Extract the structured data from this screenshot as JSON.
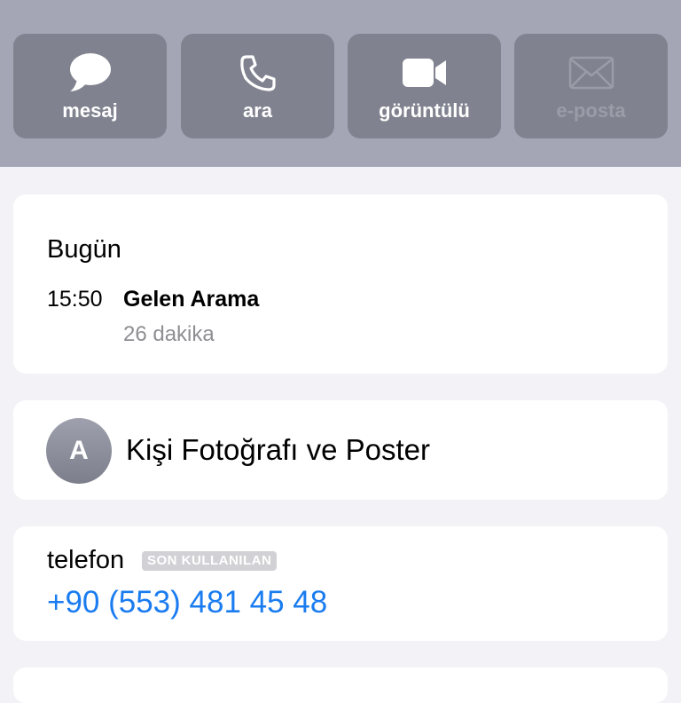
{
  "actions": [
    {
      "label": "mesaj",
      "icon": "message-bubble-icon",
      "enabled": true
    },
    {
      "label": "ara",
      "icon": "phone-icon",
      "enabled": true
    },
    {
      "label": "görüntülü",
      "icon": "video-camera-icon",
      "enabled": true
    },
    {
      "label": "e-posta",
      "icon": "envelope-icon",
      "enabled": false
    }
  ],
  "recents": {
    "title": "Bugün",
    "entries": [
      {
        "time": "15:50",
        "type": "Gelen Arama",
        "duration": "26 dakika"
      }
    ]
  },
  "contact_photo": {
    "initial": "A",
    "label": "Kişi Fotoğrafı ve Poster"
  },
  "phone": {
    "label": "telefon",
    "badge": "SON KULLANILAN",
    "number": "+90 (553) 481 45 48"
  },
  "colors": {
    "header_bg": "#a4a6b6",
    "button_bg": "#80838f",
    "link_blue": "#1a7cf0",
    "secondary_text": "#8e8e93"
  }
}
